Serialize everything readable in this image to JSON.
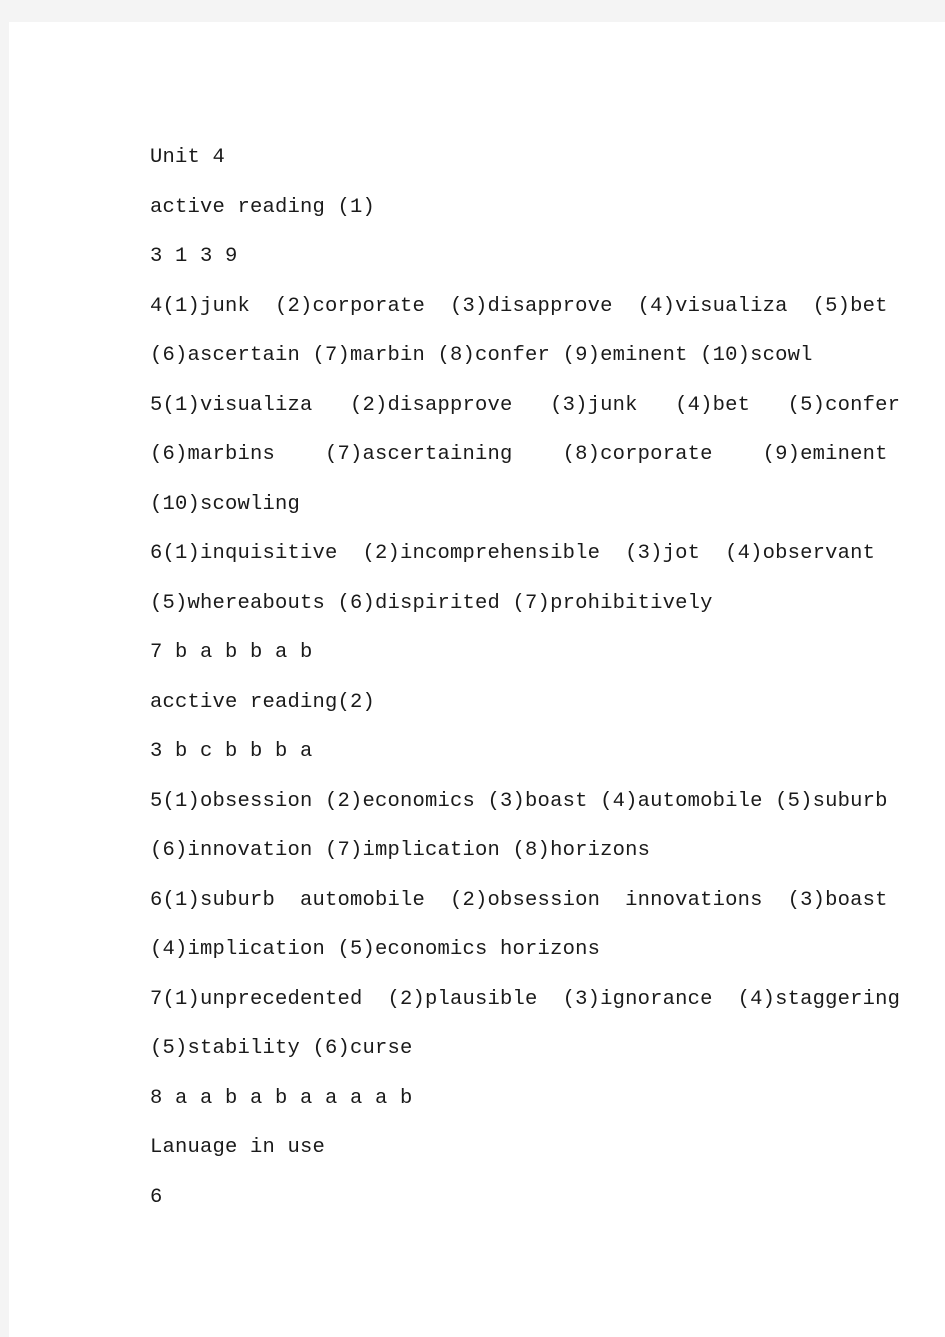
{
  "document": {
    "title": "Unit 4",
    "page_background": "#ffffff",
    "viewer_background": "#f4f4f4",
    "text_color": "#1a1a1a",
    "lines": [
      "Unit 4",
      "active reading (1)",
      "3 1 3 9",
      "4(1)junk  (2)corporate  (3)disapprove  (4)visualiza  (5)bet",
      "(6)ascertain (7)marbin (8)confer (9)eminent (10)scowl",
      "5(1)visualiza   (2)disapprove   (3)junk   (4)bet   (5)confer",
      "(6)marbins    (7)ascertaining    (8)corporate    (9)eminent",
      "(10)scowling",
      "6(1)inquisitive  (2)incomprehensible  (3)jot  (4)observant",
      "(5)whereabouts (6)dispirited (7)prohibitively",
      "7 b a b b a b",
      "acctive reading(2)",
      "3 b c b b b a",
      "5(1)obsession (2)economics (3)boast (4)automobile (5)suburb",
      "(6)innovation (7)implication (8)horizons",
      "6(1)suburb  automobile  (2)obsession  innovations  (3)boast",
      "(4)implication (5)economics horizons",
      "7(1)unprecedented  (2)plausible  (3)ignorance  (4)staggering",
      "(5)stability (6)curse",
      "8 a a b a b a a a a b",
      "Lanuage in use",
      "6"
    ],
    "sections": [
      {
        "heading": "active reading (1)",
        "items": [
          {
            "number": "3",
            "answers": "1 3 9"
          },
          {
            "number": "4",
            "answers": [
              "(1)junk",
              "(2)corporate",
              "(3)disapprove",
              "(4)visualiza",
              "(5)bet",
              "(6)ascertain",
              "(7)marbin",
              "(8)confer",
              "(9)eminent",
              "(10)scowl"
            ]
          },
          {
            "number": "5",
            "answers": [
              "(1)visualiza",
              "(2)disapprove",
              "(3)junk",
              "(4)bet",
              "(5)confer",
              "(6)marbins",
              "(7)ascertaining",
              "(8)corporate",
              "(9)eminent",
              "(10)scowling"
            ]
          },
          {
            "number": "6",
            "answers": [
              "(1)inquisitive",
              "(2)incomprehensible",
              "(3)jot",
              "(4)observant",
              "(5)whereabouts",
              "(6)dispirited",
              "(7)prohibitively"
            ]
          },
          {
            "number": "7",
            "answers": "b a b b a b"
          }
        ]
      },
      {
        "heading": "acctive reading(2)",
        "items": [
          {
            "number": "3",
            "answers": "b c b b b a"
          },
          {
            "number": "5",
            "answers": [
              "(1)obsession",
              "(2)economics",
              "(3)boast",
              "(4)automobile",
              "(5)suburb",
              "(6)innovation",
              "(7)implication",
              "(8)horizons"
            ]
          },
          {
            "number": "6",
            "answers": [
              "(1)suburb  automobile",
              "(2)obsession  innovations",
              "(3)boast",
              "(4)implication",
              "(5)economics horizons"
            ]
          },
          {
            "number": "7",
            "answers": [
              "(1)unprecedented",
              "(2)plausible",
              "(3)ignorance",
              "(4)staggering",
              "(5)stability",
              "(6)curse"
            ]
          },
          {
            "number": "8",
            "answers": "a a b a b a a a a b"
          }
        ]
      },
      {
        "heading": "Lanuage in use",
        "items": [
          {
            "number": "6",
            "answers": ""
          }
        ]
      }
    ]
  }
}
